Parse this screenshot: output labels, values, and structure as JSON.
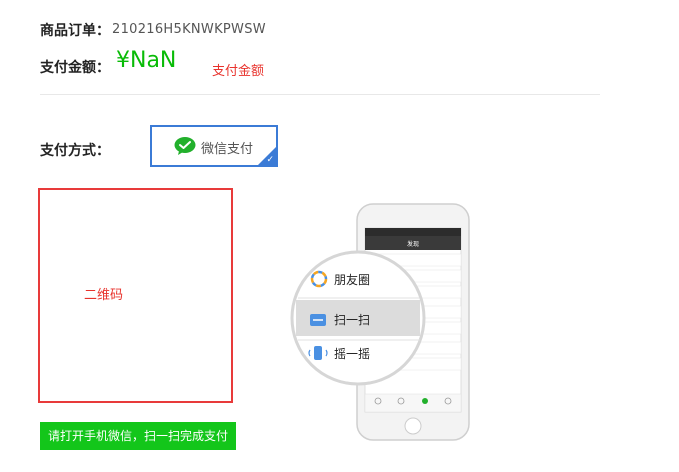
{
  "order": {
    "label": "商品订单：",
    "number": "210216H5KNWKPWSW"
  },
  "amount": {
    "label": "支付金额：",
    "value": "¥NaN",
    "note": "支付金额",
    "value_color": "#09bb07",
    "note_color": "#e8322c"
  },
  "payment": {
    "label": "支付方式：",
    "option_label": "微信支付",
    "option_selected": true,
    "selected_border_color": "#3b7bd6"
  },
  "qr": {
    "placeholder": "二维码",
    "border_color": "#e83a3a"
  },
  "hint": {
    "text": "请打开手机微信，扫一扫完成支付",
    "background_color": "#13c61a"
  },
  "phone": {
    "header_title": "发现",
    "menu": [
      {
        "label": "朋友圈",
        "icon": "moments-icon"
      },
      {
        "label": "扫一扫",
        "icon": "scan-icon"
      },
      {
        "label": "摇一摇",
        "icon": "shake-icon"
      }
    ]
  }
}
